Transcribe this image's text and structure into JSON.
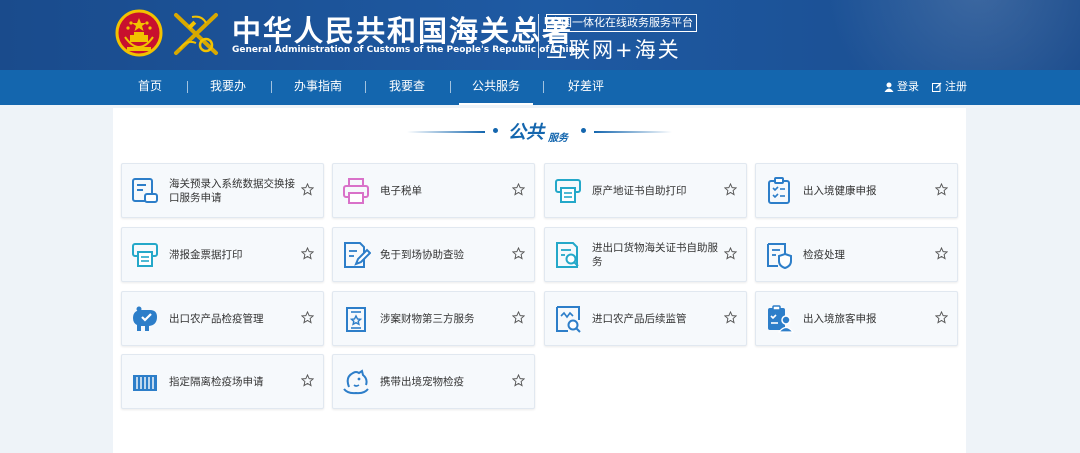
{
  "header": {
    "org_name_cn": "中华人民共和国海关总署",
    "org_name_en": "General Administration of Customs of the People's Republic of China",
    "platform_tag": "全国一体化在线政务服务平台",
    "platform_name": "互联网+海关"
  },
  "nav": {
    "items": [
      {
        "label": "首页"
      },
      {
        "label": "我要办"
      },
      {
        "label": "办事指南"
      },
      {
        "label": "我要查"
      },
      {
        "label": "公共服务"
      },
      {
        "label": "好差评"
      }
    ],
    "active_label": "公共服务",
    "login_label": "登录",
    "register_label": "注册"
  },
  "section": {
    "title_main": "公共",
    "title_sub": "服务"
  },
  "services": [
    {
      "label": "海关预录入系统数据交换接口服务申请",
      "icon": "data-exchange-icon",
      "color": "#2d7ec9"
    },
    {
      "label": "电子税单",
      "icon": "printer-icon",
      "color": "#d971c9"
    },
    {
      "label": "原产地证书自助打印",
      "icon": "printer-icon",
      "color": "#24a8c9"
    },
    {
      "label": "出入境健康申报",
      "icon": "checklist-icon",
      "color": "#2d7ec9"
    },
    {
      "label": "滞报金票据打印",
      "icon": "printer-icon",
      "color": "#24a8c9"
    },
    {
      "label": "免于到场协助查验",
      "icon": "document-edit-icon",
      "color": "#2d7ec9"
    },
    {
      "label": "进出口货物海关证书自助服务",
      "icon": "document-search-icon",
      "color": "#24a8c9"
    },
    {
      "label": "检疫处理",
      "icon": "shield-document-icon",
      "color": "#2d7ec9"
    },
    {
      "label": "出口农产品检疫管理",
      "icon": "animal-check-icon",
      "color": "#2d7ec9"
    },
    {
      "label": "涉案财物第三方服务",
      "icon": "certificate-icon",
      "color": "#2d7ec9"
    },
    {
      "label": "进口农产品后续监管",
      "icon": "monitor-search-icon",
      "color": "#2d7ec9"
    },
    {
      "label": "出入境旅客申报",
      "icon": "traveler-clipboard-icon",
      "color": "#2d7ec9"
    },
    {
      "label": "指定隔离检疫场申请",
      "icon": "container-icon",
      "color": "#2d7ec9"
    },
    {
      "label": "携带出境宠物检疫",
      "icon": "pet-icon",
      "color": "#2d7ec9"
    }
  ]
}
